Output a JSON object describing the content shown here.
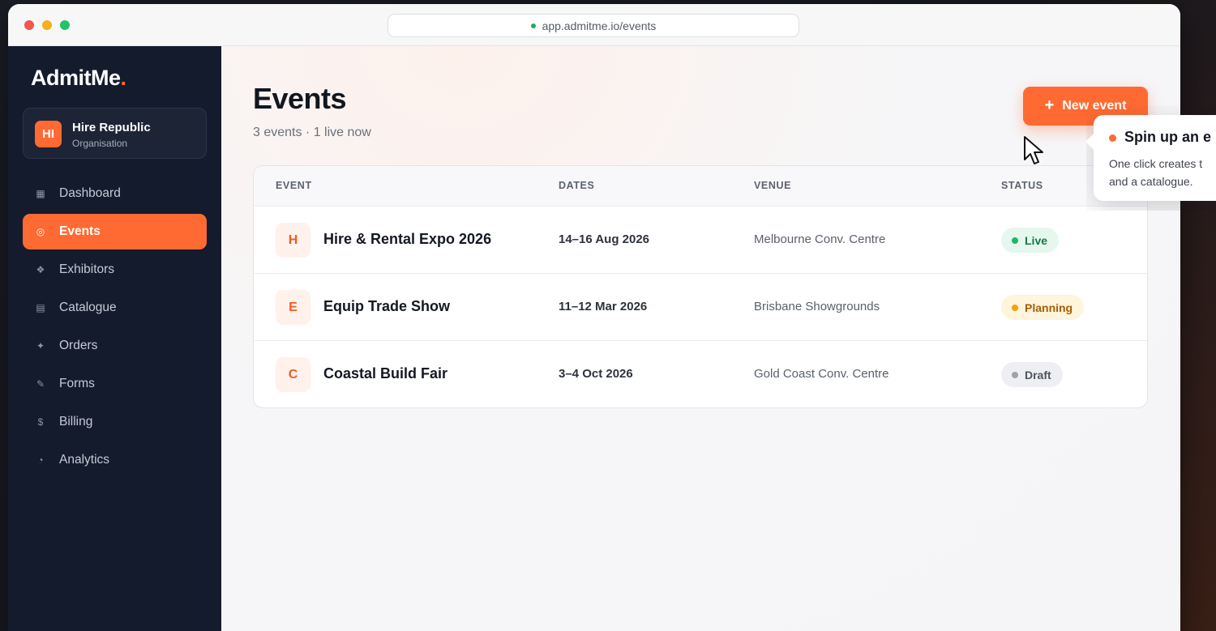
{
  "browser": {
    "url": "app.admitme.io/events"
  },
  "brand": {
    "name_main": "AdmitMe",
    "name_accent": ".",
    "accent_color": "#ff6a33"
  },
  "org": {
    "initials": "HI",
    "name": "Hire Republic",
    "type": "Organisation"
  },
  "sidebar": {
    "items": [
      {
        "label": "Dashboard",
        "icon": "grid-icon",
        "glyph": "▦"
      },
      {
        "label": "Events",
        "icon": "target-icon",
        "glyph": "◎",
        "active": true
      },
      {
        "label": "Exhibitors",
        "icon": "diamond-icon",
        "glyph": "❖"
      },
      {
        "label": "Catalogue",
        "icon": "list-icon",
        "glyph": "▤"
      },
      {
        "label": "Orders",
        "icon": "sparkle-icon",
        "glyph": "✦"
      },
      {
        "label": "Forms",
        "icon": "pencil-icon",
        "glyph": "✎"
      },
      {
        "label": "Billing",
        "icon": "dollar-icon",
        "glyph": "$"
      },
      {
        "label": "Analytics",
        "icon": "pie-chart-icon",
        "glyph": "◔"
      }
    ]
  },
  "header": {
    "title": "Events",
    "subtitle": "3 events · 1 live now",
    "new_button_plus": "+",
    "new_button_label": "New event"
  },
  "table": {
    "columns": [
      "EVENT",
      "DATES",
      "VENUE",
      "STATUS"
    ],
    "rows": [
      {
        "initial": "H",
        "name": "Hire & Rental Expo 2026",
        "dates": "14–16 Aug 2026",
        "venue": "Melbourne Conv. Centre",
        "status": "Live"
      },
      {
        "initial": "E",
        "name": "Equip Trade Show",
        "dates": "11–12 Mar 2026",
        "venue": "Brisbane Showgrounds",
        "status": "Planning"
      },
      {
        "initial": "C",
        "name": "Coastal Build Fair",
        "dates": "3–4 Oct 2026",
        "venue": "Gold Coast Conv. Centre",
        "status": "Draft"
      }
    ]
  },
  "tooltip": {
    "title": "Spin up an e",
    "line1": "One click creates t",
    "line2": "and a catalogue."
  }
}
